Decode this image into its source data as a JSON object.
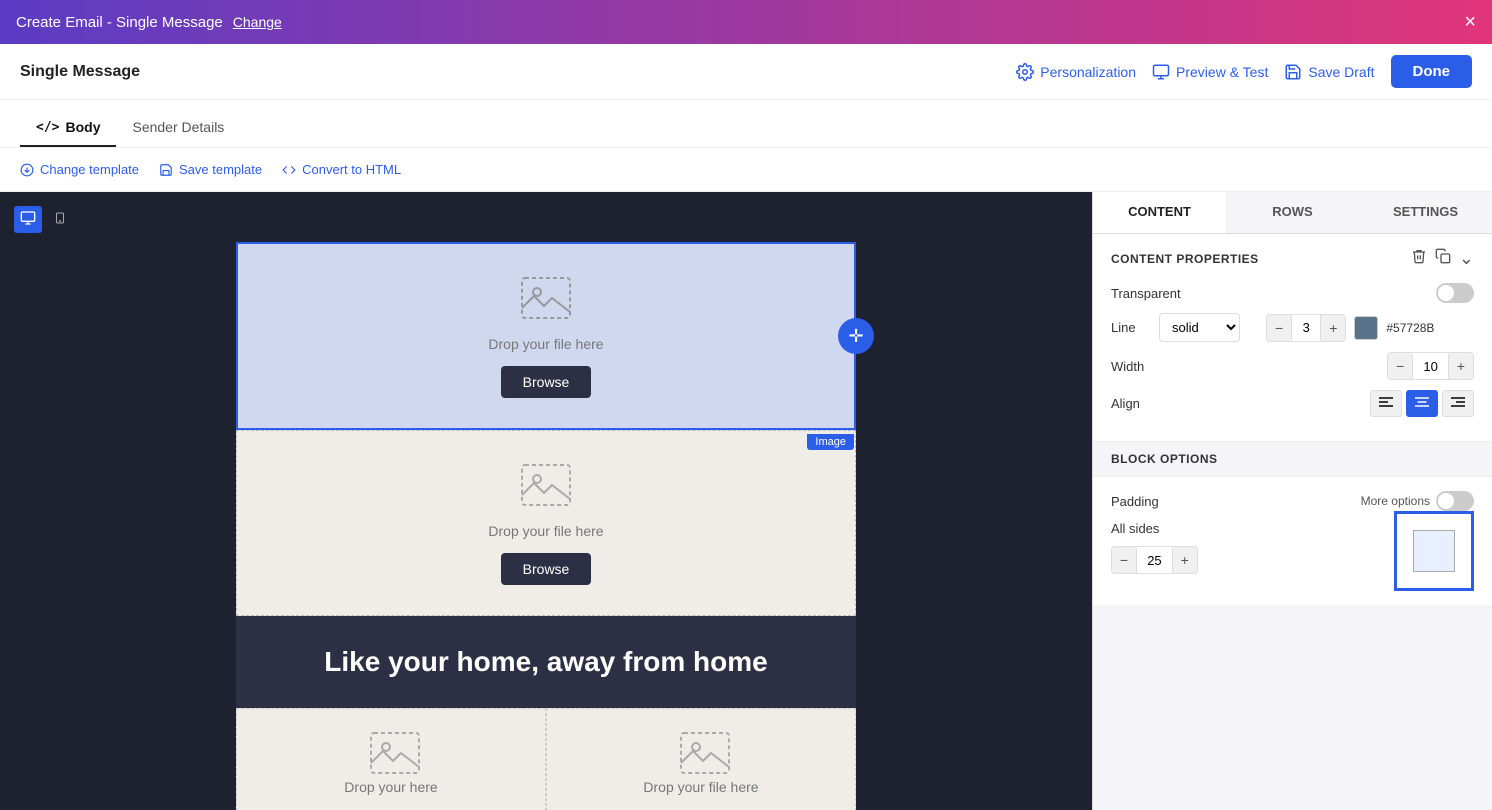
{
  "topBar": {
    "title": "Create Email - Single Message",
    "changeLabel": "Change",
    "closeLabel": "×"
  },
  "subHeader": {
    "title": "Single Message",
    "personalizationLabel": "Personalization",
    "previewLabel": "Preview & Test",
    "saveDraftLabel": "Save Draft",
    "doneLabel": "Done"
  },
  "tabs": [
    {
      "id": "body",
      "label": "Body",
      "icon": "</>",
      "active": true
    },
    {
      "id": "sender",
      "label": "Sender Details",
      "active": false
    }
  ],
  "toolbar": {
    "changeTemplateLabel": "Change template",
    "saveTemplateLabel": "Save template",
    "convertHtmlLabel": "Convert to HTML"
  },
  "canvas": {
    "imageBlock1": {
      "dropText": "Drop your file here",
      "browseLabel": "Browse",
      "moveIcon": "✛",
      "imageLabel": "Image"
    },
    "imageBlock2": {
      "dropText": "Drop your file here",
      "browseLabel": "Browse"
    },
    "textBlock": {
      "text": "Like your home, away from home"
    },
    "col1": {
      "dropText": "Drop your here"
    },
    "col2": {
      "dropText": "Drop your file here"
    }
  },
  "rightPanel": {
    "tabs": [
      {
        "id": "content",
        "label": "CONTENT",
        "active": true
      },
      {
        "id": "rows",
        "label": "ROWS",
        "active": false
      },
      {
        "id": "settings",
        "label": "SETTINGS",
        "active": false
      }
    ],
    "contentProperties": {
      "title": "CONTENT PROPERTIES",
      "transparent": {
        "label": "Transparent",
        "on": false
      },
      "line": {
        "label": "Line",
        "style": "solid",
        "width": 3,
        "color": "#57728B"
      },
      "width": {
        "label": "Width",
        "value": 10
      },
      "align": {
        "label": "Align",
        "options": [
          "left",
          "center",
          "right"
        ],
        "active": "center"
      }
    },
    "blockOptions": {
      "title": "BLOCK OPTIONS",
      "padding": {
        "label": "Padding",
        "moreOptions": "More options",
        "moreOptionsOn": false,
        "allSides": {
          "label": "All sides",
          "value": 25
        }
      }
    }
  }
}
